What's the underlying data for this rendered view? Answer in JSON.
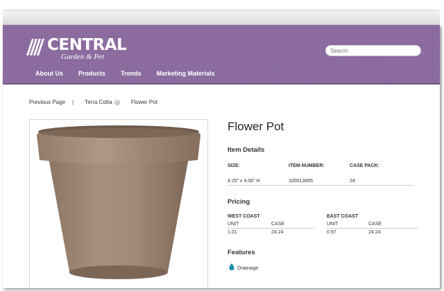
{
  "logo": {
    "word": "CENTRAL",
    "sub": "Garden & Pet"
  },
  "search": {
    "placeholder": "Search"
  },
  "nav": [
    "About Us",
    "Products",
    "Trends",
    "Marketing Materials"
  ],
  "breadcrumb": {
    "previous": "Previous Page",
    "separator": "|",
    "category": "Terra Cotta",
    "current": "Flower Pot"
  },
  "product": {
    "title": "Flower Pot",
    "details_heading": "Item Details",
    "size_label": "SIZE:",
    "item_number_label": "ITEM NUMBER:",
    "case_pack_label": "CASE PACK:",
    "size": "4.25\" x 4.00\" H",
    "item_number": "100013895",
    "case_pack": "24",
    "pricing_heading": "Pricing",
    "west_label": "WEST COAST",
    "east_label": "EAST COAST",
    "unit_label": "UNIT",
    "case_label": "CASE",
    "west_unit": "1.01",
    "west_case": "24.24",
    "east_unit": "0.97",
    "east_case": "24.24",
    "features_heading": "Features",
    "features": [
      "Drainage"
    ]
  },
  "colors": {
    "header": "#8a6a9e",
    "drop_icon": "#1f8fa8"
  }
}
